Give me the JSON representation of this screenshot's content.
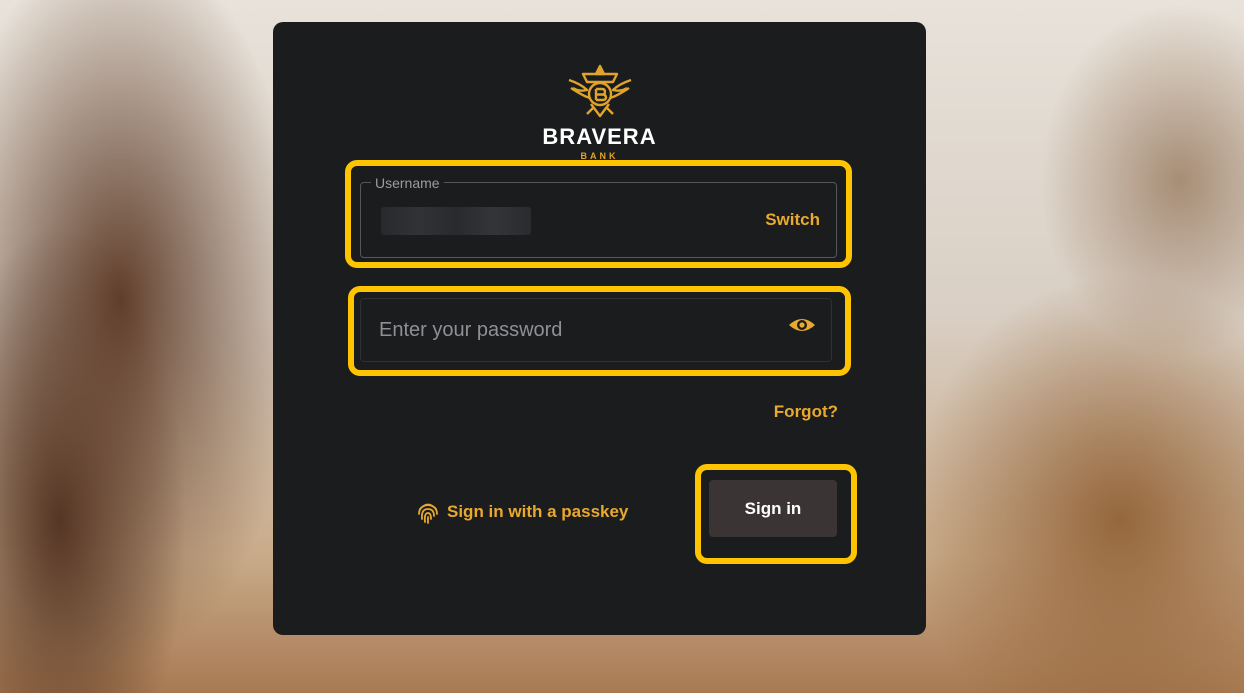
{
  "brand": {
    "name": "BRAVERA",
    "sub": "BANK",
    "logo_icon": "eagle-crest-icon"
  },
  "username": {
    "label": "Username",
    "value": "",
    "switch_label": "Switch"
  },
  "password": {
    "placeholder": "Enter your password",
    "toggle_icon": "eye-icon"
  },
  "forgot_label": "Forgot?",
  "passkey": {
    "label": "Sign in with a passkey",
    "icon": "fingerprint-icon"
  },
  "signin_label": "Sign in",
  "colors": {
    "accent": "#e8a92e",
    "highlight": "#ffc400",
    "card_bg": "#1b1c1e",
    "signin_bg": "#3a3534"
  }
}
